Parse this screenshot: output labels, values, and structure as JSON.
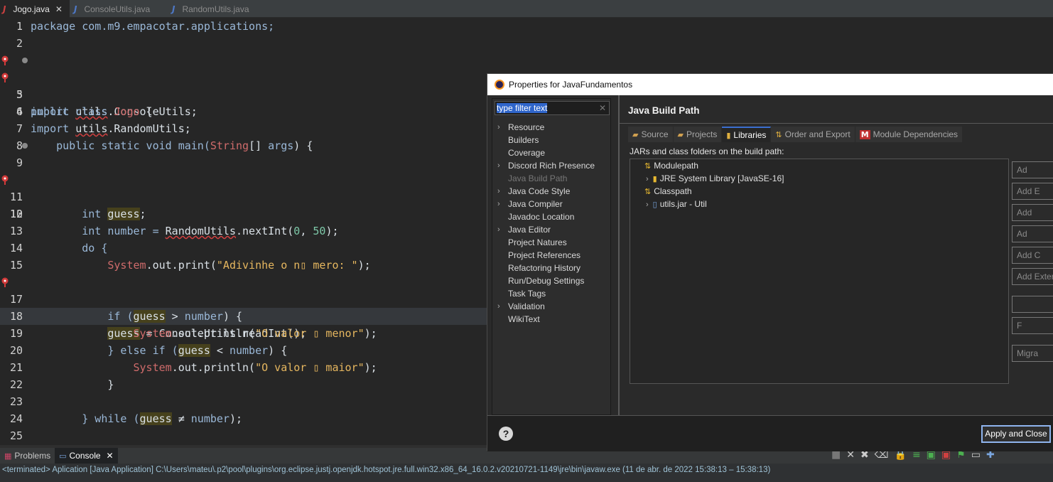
{
  "editor_tabs": [
    {
      "label": "Jogo.java",
      "icon": "java-file-icon",
      "active": true
    },
    {
      "label": "ConsoleUtils.java",
      "icon": "java-file-icon"
    },
    {
      "label": "RandomUtils.java",
      "icon": "java-file-icon"
    }
  ],
  "code_lines": [
    {
      "n": "1"
    },
    {
      "n": "2"
    },
    {
      "n": "3"
    },
    {
      "n": "4"
    },
    {
      "n": "5"
    },
    {
      "n": "6"
    },
    {
      "n": "7"
    },
    {
      "n": "8"
    },
    {
      "n": "9"
    },
    {
      "n": "10"
    },
    {
      "n": "11"
    },
    {
      "n": "12"
    },
    {
      "n": "13"
    },
    {
      "n": "14"
    },
    {
      "n": "15"
    },
    {
      "n": "16"
    },
    {
      "n": "17"
    },
    {
      "n": "18"
    },
    {
      "n": "19"
    },
    {
      "n": "20"
    },
    {
      "n": "21"
    },
    {
      "n": "22"
    },
    {
      "n": "23"
    },
    {
      "n": "24"
    },
    {
      "n": "25"
    }
  ],
  "code": {
    "l1": "package com.m9.empacotar.applications;",
    "l3a": "import ",
    "l3b": "utils",
    "l3c": ".ConsoleUtils;",
    "l4a": "import ",
    "l4b": "utils",
    "l4c": ".RandomUtils;",
    "l6a": "public class ",
    "l6b": "Jogo",
    "l6c": " {",
    "l8a": "    public static void main(",
    "l8b": "String",
    "l8c": "[] ",
    "l8d": "args",
    "l8e": ") {",
    "l10a": "        int number = ",
    "l10b": "RandomUtils",
    "l10c": ".nextInt(",
    "l10d": "0",
    "l10e": ", ",
    "l10f": "50",
    "l10g": ");",
    "l12a": "        int ",
    "l12b": "guess",
    "l12c": ";",
    "l14": "        do {",
    "l15a": "            ",
    "l15b": "System",
    "l15c": ".out.print(",
    "l15d": "\"Adivinhe o n▯ mero: \"",
    "l15e": ");",
    "l16a": "            ",
    "l16b": "guess",
    "l16c": " = ConsoleUtils.readInt();",
    "l18a": "            if (",
    "l18b": "guess",
    "l18c": " > ",
    "l18d": "number",
    "l18e": ") {",
    "l19a": "                ",
    "l19b": "System",
    "l19c": ".out.println(",
    "l19d": "\"O valor ▯ menor\"",
    "l19e": ");",
    "l20a": "            } else if (",
    "l20b": "guess",
    "l20c": " < ",
    "l20d": "number",
    "l20e": ") {",
    "l21a": "                ",
    "l21b": "System",
    "l21c": ".out.println(",
    "l21d": "\"O valor ▯ maior\"",
    "l21e": ");",
    "l22": "            }",
    "l24a": "        } while (",
    "l24b": "guess",
    "l24c": " ≠ ",
    "l24d": "number",
    "l24e": ");"
  },
  "bottom": {
    "problems_tab": "Problems",
    "console_tab": "Console",
    "status": "<terminated> Aplication [Java Application] C:\\Users\\mateu\\.p2\\pool\\plugins\\org.eclipse.justj.openjdk.hotspot.jre.full.win32.x86_64_16.0.2.v20210721-1149\\jre\\bin\\javaw.exe  (11 de abr. de 2022 15:38:13 – 15:38:13)"
  },
  "dialog": {
    "title": "Properties for JavaFundamentos",
    "filter_value": "type filter text",
    "tree": [
      {
        "label": "Resource",
        "expandable": true
      },
      {
        "label": "Builders",
        "expandable": false
      },
      {
        "label": "Coverage",
        "expandable": false
      },
      {
        "label": "Discord Rich Presence",
        "expandable": true
      },
      {
        "label": "Java Build Path",
        "expandable": false,
        "selected": true
      },
      {
        "label": "Java Code Style",
        "expandable": true
      },
      {
        "label": "Java Compiler",
        "expandable": true
      },
      {
        "label": "Javadoc Location",
        "expandable": false
      },
      {
        "label": "Java Editor",
        "expandable": true
      },
      {
        "label": "Project Natures",
        "expandable": false
      },
      {
        "label": "Project References",
        "expandable": false
      },
      {
        "label": "Refactoring History",
        "expandable": false
      },
      {
        "label": "Run/Debug Settings",
        "expandable": false
      },
      {
        "label": "Task Tags",
        "expandable": false
      },
      {
        "label": "Validation",
        "expandable": true
      },
      {
        "label": "WikiText",
        "expandable": false
      }
    ],
    "page_title": "Java Build Path",
    "tabs": [
      {
        "label": "Source",
        "icon": "folder-icon"
      },
      {
        "label": "Projects",
        "icon": "folder-icon"
      },
      {
        "label": "Libraries",
        "icon": "library-icon",
        "active": true
      },
      {
        "label": "Order and Export",
        "icon": "order-icon"
      },
      {
        "label": "Module Dependencies",
        "icon": "module-icon"
      }
    ],
    "libraries_label": "JARs and class folders on the build path:",
    "build_tree": {
      "modulepath": "Modulepath",
      "jre": "JRE System Library [JavaSE-16]",
      "classpath": "Classpath",
      "utils": "utils.jar - Util"
    },
    "side_buttons": [
      "Ad",
      "Add E",
      "Add",
      "Ad",
      "Add C",
      "Add Exter",
      "",
      "F",
      "Migra"
    ],
    "apply_close": "Apply and Close"
  }
}
